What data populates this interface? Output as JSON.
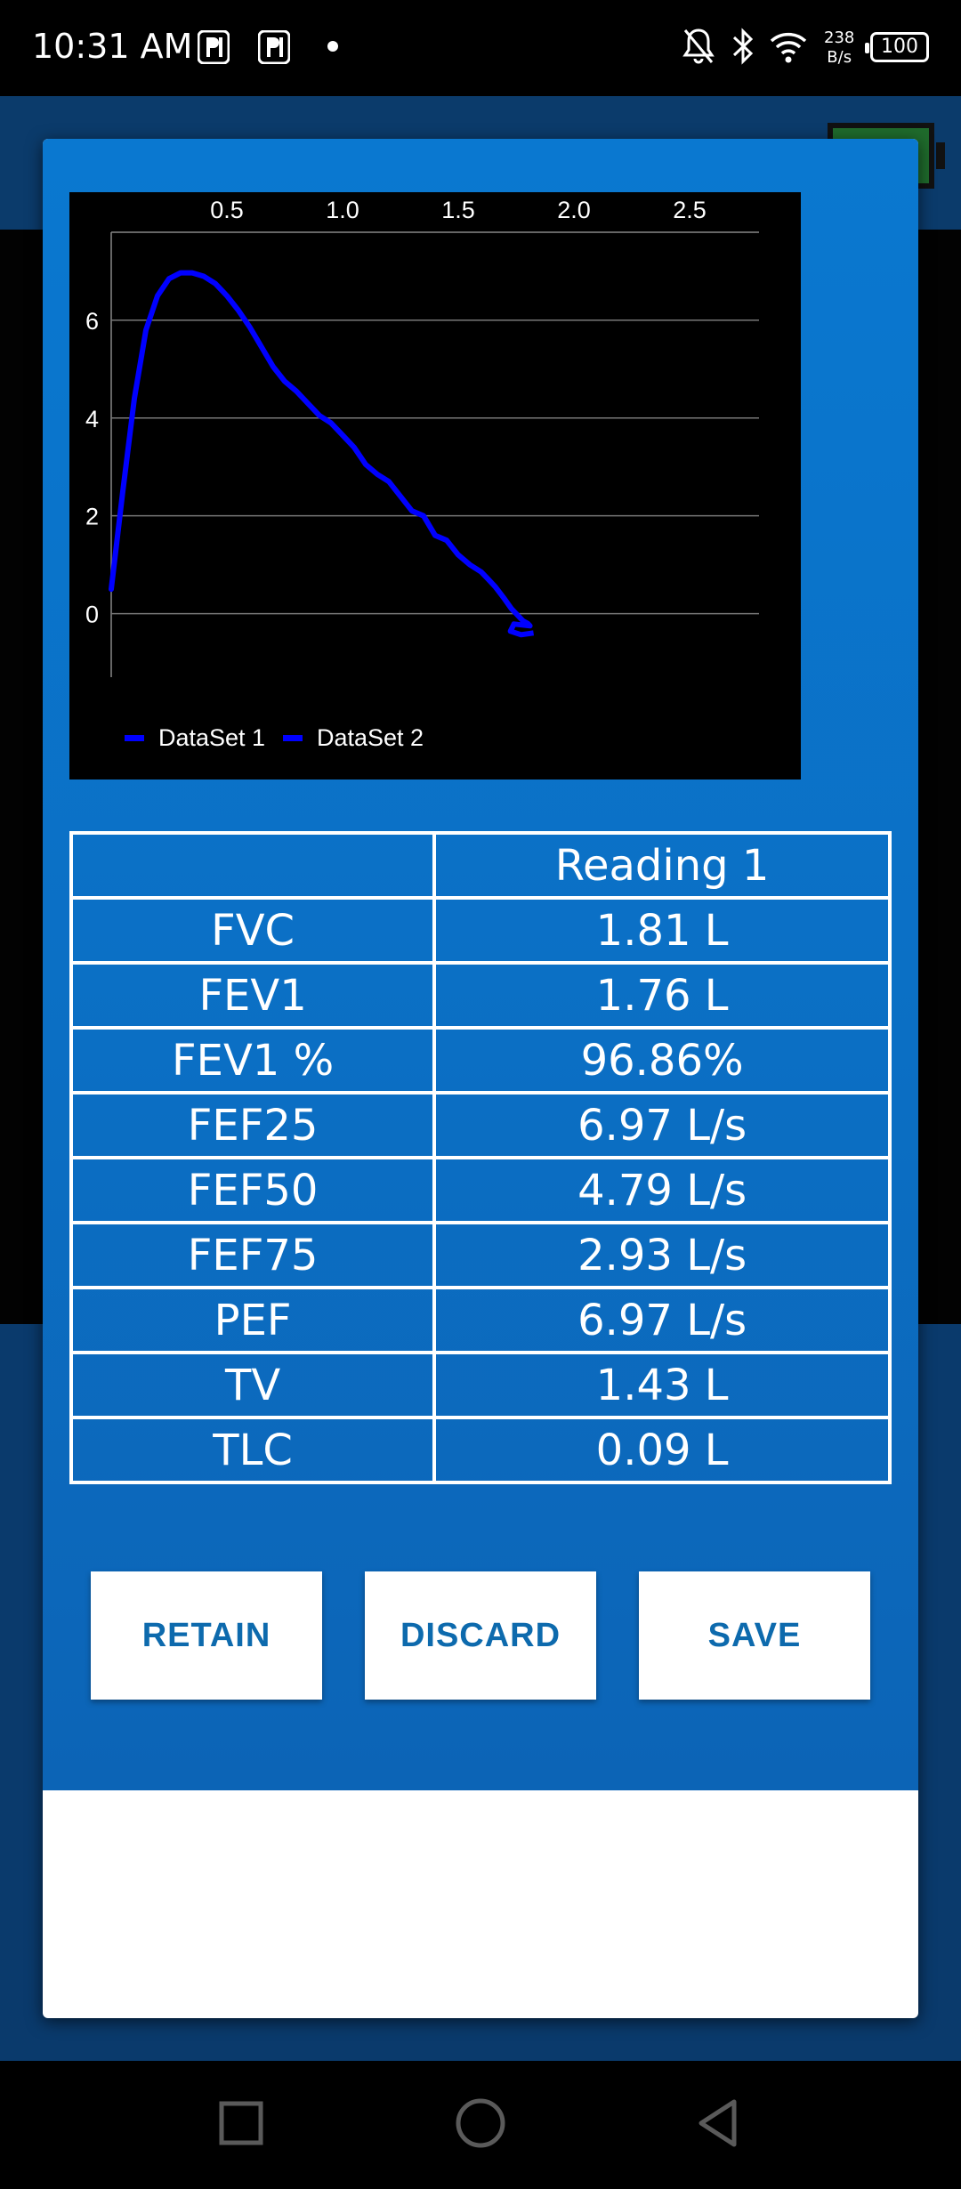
{
  "status_bar": {
    "time": "10:31 AM",
    "speed_value": "238",
    "speed_unit": "B/s",
    "battery": "100",
    "icons": [
      "app-icon",
      "app-icon",
      "notification-dot",
      "mute-bell-icon",
      "bluetooth-icon",
      "wifi-icon",
      "battery-icon"
    ]
  },
  "chart_data": {
    "type": "line",
    "x_ticks": [
      "0.5",
      "1.0",
      "1.5",
      "2.0",
      "2.5"
    ],
    "y_ticks": [
      "0",
      "2",
      "4",
      "6"
    ],
    "xlim": [
      0,
      2.8
    ],
    "ylim": [
      -1.3,
      7.8
    ],
    "grid": true,
    "legend_position": "bottom-left",
    "series": [
      {
        "name": "DataSet 1",
        "color": "#0000ff",
        "x": [
          0.0,
          0.05,
          0.1,
          0.15,
          0.2,
          0.25,
          0.3,
          0.35,
          0.4,
          0.45,
          0.5,
          0.55,
          0.6,
          0.65,
          0.7,
          0.75,
          0.8,
          0.85,
          0.9,
          0.95,
          1.0,
          1.05,
          1.1,
          1.15,
          1.2,
          1.25,
          1.3,
          1.35,
          1.4,
          1.45,
          1.5,
          1.55,
          1.6,
          1.63,
          1.66,
          1.7,
          1.73,
          1.76,
          1.78,
          1.8,
          1.81
        ],
        "y": [
          0.5,
          2.5,
          4.4,
          5.8,
          6.5,
          6.85,
          6.97,
          6.97,
          6.9,
          6.75,
          6.5,
          6.2,
          5.85,
          5.45,
          5.05,
          4.75,
          4.55,
          4.3,
          4.05,
          3.9,
          3.65,
          3.4,
          3.05,
          2.85,
          2.7,
          2.4,
          2.1,
          2.0,
          1.6,
          1.5,
          1.2,
          1.0,
          0.85,
          0.7,
          0.55,
          0.3,
          0.1,
          -0.05,
          -0.15,
          -0.2,
          -0.25
        ]
      },
      {
        "name": "DataSet 2",
        "color": "#0000ff",
        "x": [],
        "y": []
      }
    ]
  },
  "table": {
    "header": [
      "",
      "Reading 1"
    ],
    "rows": [
      {
        "label": "FVC",
        "value": "1.81 L"
      },
      {
        "label": "FEV1",
        "value": "1.76 L"
      },
      {
        "label": "FEV1 %",
        "value": "96.86%"
      },
      {
        "label": "FEF25",
        "value": "6.97 L/s"
      },
      {
        "label": "FEF50",
        "value": "4.79 L/s"
      },
      {
        "label": "FEF75",
        "value": "2.93 L/s"
      },
      {
        "label": "PEF",
        "value": "6.97 L/s"
      },
      {
        "label": "TV",
        "value": "1.43 L"
      },
      {
        "label": "TLC",
        "value": "0.09 L"
      }
    ]
  },
  "buttons": {
    "retain": "RETAIN",
    "discard": "DISCARD",
    "save": "SAVE"
  },
  "nav_bar": {
    "icons": [
      "recents-square-icon",
      "home-circle-icon",
      "back-triangle-icon"
    ]
  }
}
